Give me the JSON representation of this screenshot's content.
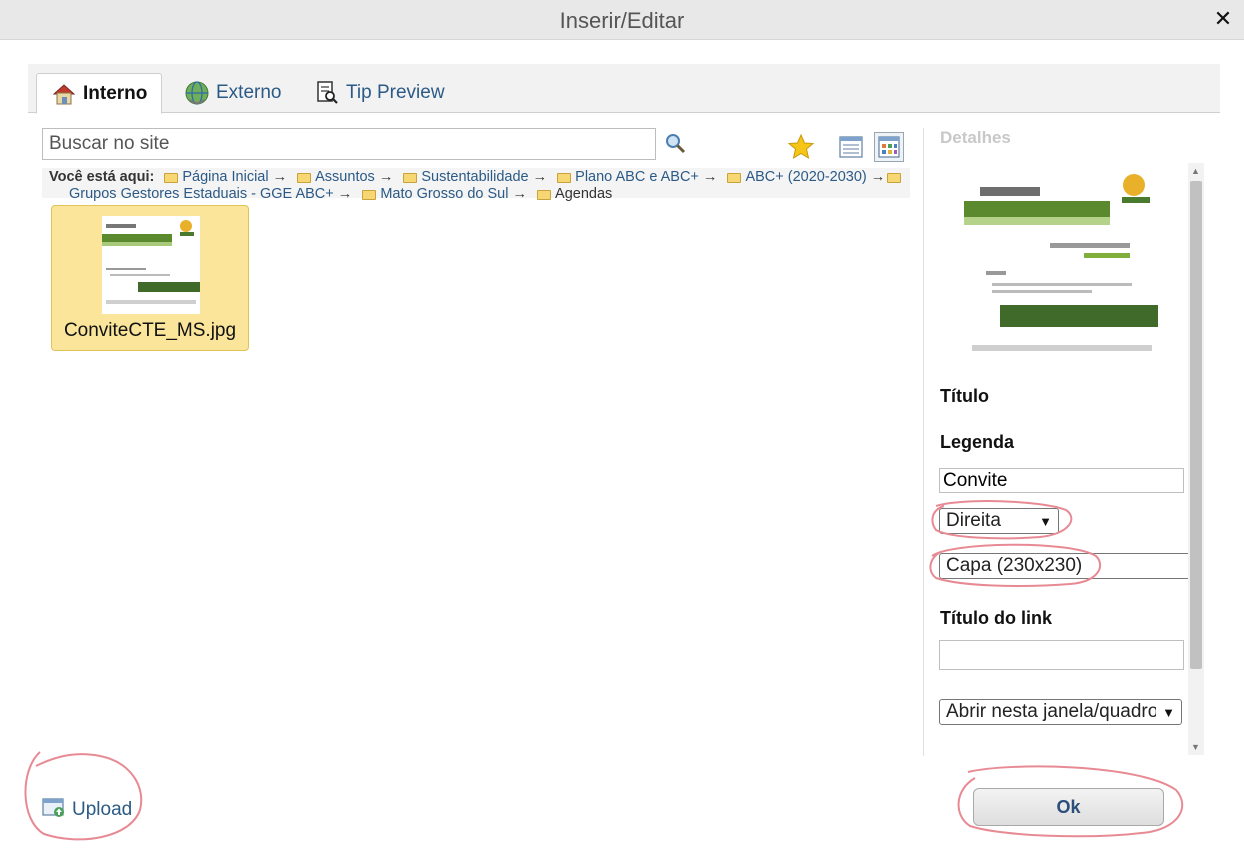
{
  "window": {
    "title": "Inserir/Editar",
    "close_symbol": "✕"
  },
  "tabs": [
    {
      "label": "Interno",
      "icon": "house-icon",
      "active": true
    },
    {
      "label": "Externo",
      "icon": "globe-icon",
      "active": false
    },
    {
      "label": "Tip Preview",
      "icon": "document-magnifier-icon",
      "active": false
    }
  ],
  "search": {
    "placeholder": "Buscar no site"
  },
  "breadcrumb": {
    "label": "Você está aqui:",
    "items": [
      "Página Inicial",
      "Assuntos",
      "Sustentabilidade",
      "Plano ABC e ABC+",
      "ABC+ (2020-2030)",
      "Grupos Gestores Estaduais - GGE ABC+",
      "Mato Grosso do Sul",
      "Agendas"
    ],
    "separator": "→"
  },
  "files": [
    {
      "name": "ConviteCTE_MS.jpg",
      "selected": true
    }
  ],
  "details": {
    "heading": "Detalhes",
    "titulo_label": "Título",
    "legenda_label": "Legenda",
    "legenda_value": "Convite",
    "alignment_value": "Direita",
    "size_value": "Capa (230x230)",
    "link_title_label": "Título do link",
    "link_title_value": "",
    "target_value": "Abrir nesta janela/quadro"
  },
  "footer": {
    "upload_label": "Upload",
    "ok_label": "Ok"
  },
  "colors": {
    "link": "#2b5a86",
    "selected_tile": "#fae59a",
    "annotation": "#e88a94"
  }
}
